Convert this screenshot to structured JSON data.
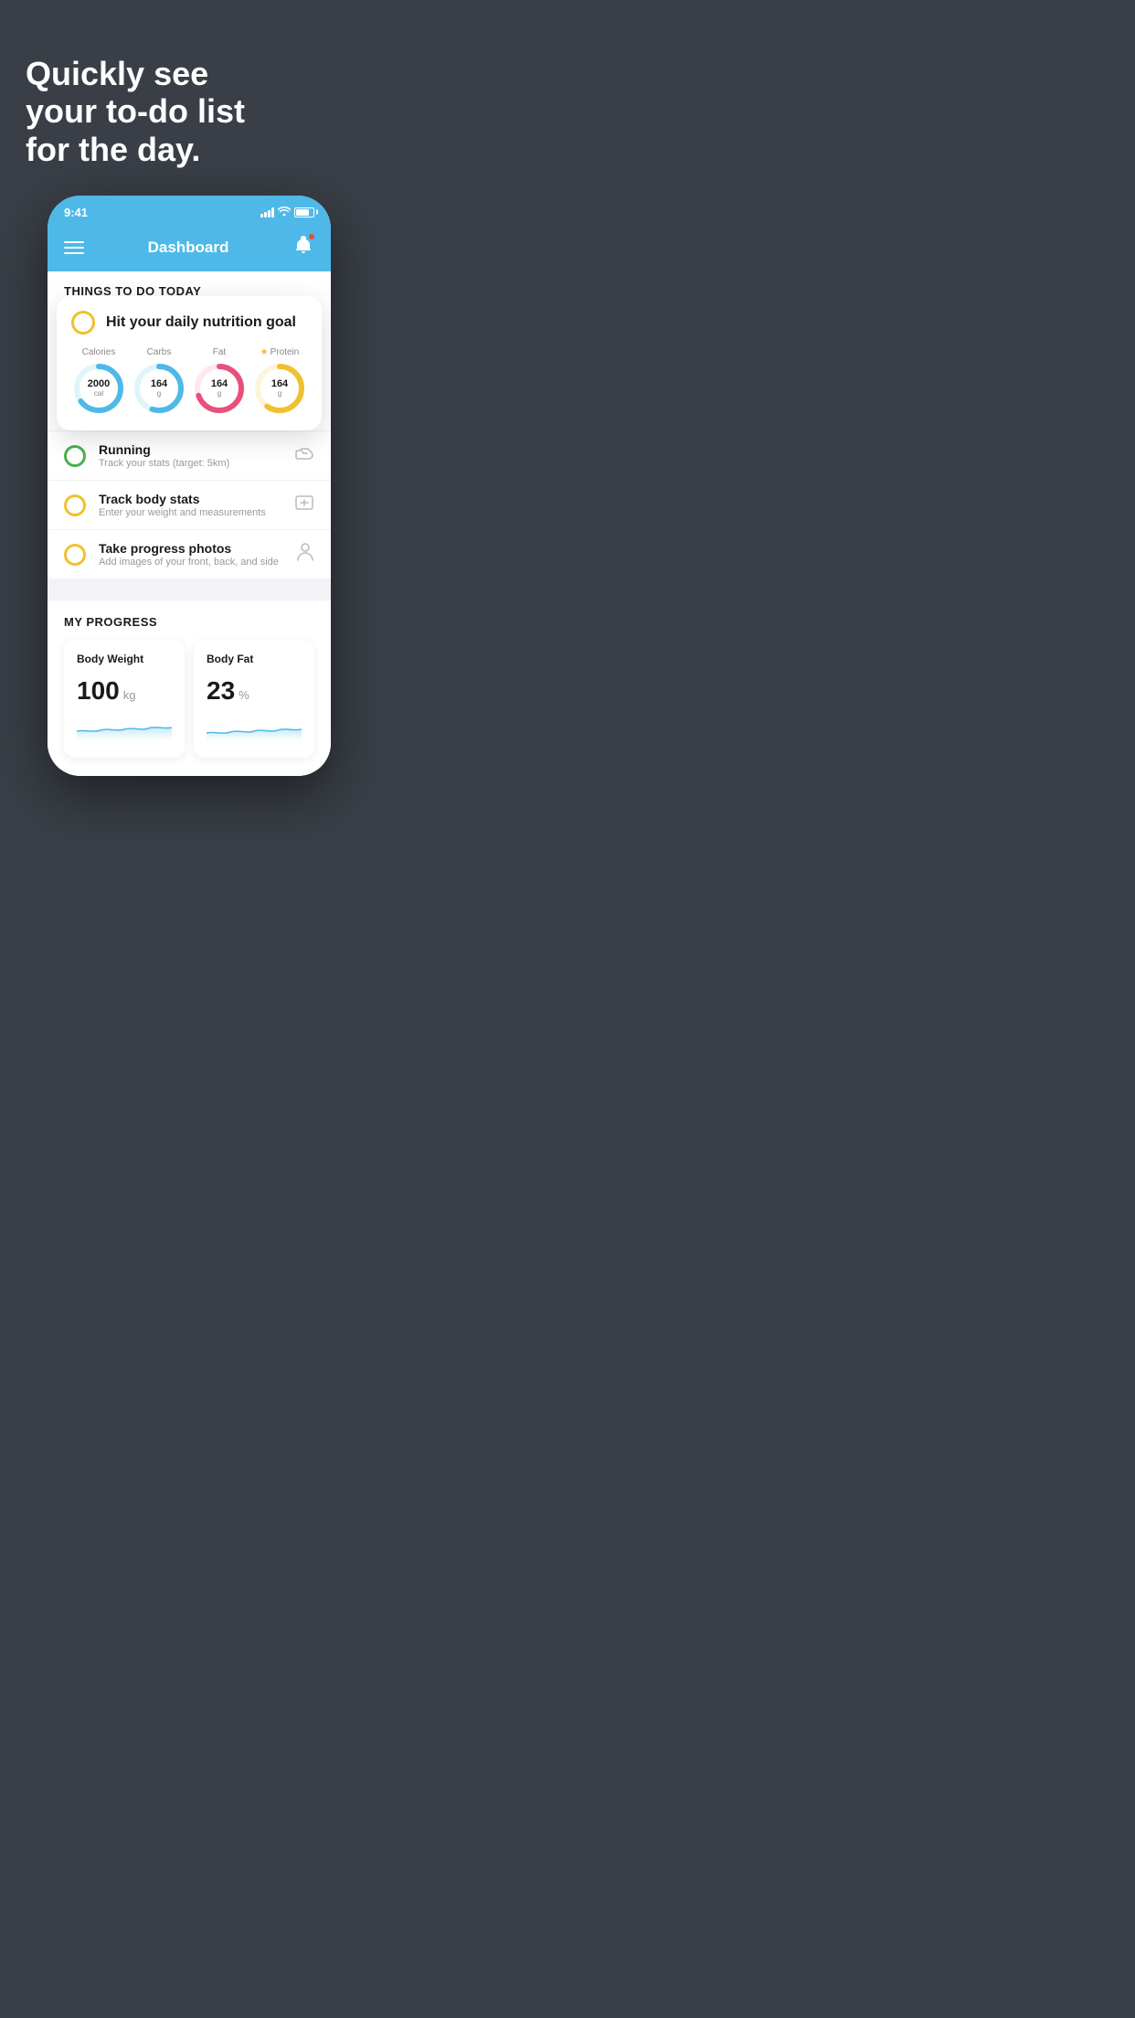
{
  "hero": {
    "line1": "Quickly see",
    "line2": "your to-do list",
    "line3": "for the day."
  },
  "statusBar": {
    "time": "9:41"
  },
  "navBar": {
    "title": "Dashboard"
  },
  "thingsToDoSection": {
    "header": "THINGS TO DO TODAY"
  },
  "nutritionCard": {
    "title": "Hit your daily nutrition goal",
    "items": [
      {
        "label": "Calories",
        "value": "2000",
        "unit": "cal",
        "color": "#4eb9e8",
        "trackColor": "#e0f4fb",
        "percent": 65,
        "star": false
      },
      {
        "label": "Carbs",
        "value": "164",
        "unit": "g",
        "color": "#4eb9e8",
        "trackColor": "#e0f4fb",
        "percent": 55,
        "star": false
      },
      {
        "label": "Fat",
        "value": "164",
        "unit": "g",
        "color": "#e8507a",
        "trackColor": "#fce8ee",
        "percent": 70,
        "star": false
      },
      {
        "label": "Protein",
        "value": "164",
        "unit": "g",
        "color": "#f0c030",
        "trackColor": "#fdf5dc",
        "percent": 60,
        "star": true
      }
    ]
  },
  "todoItems": [
    {
      "title": "Running",
      "subtitle": "Track your stats (target: 5km)",
      "circleColor": "green",
      "icon": "shoe"
    },
    {
      "title": "Track body stats",
      "subtitle": "Enter your weight and measurements",
      "circleColor": "yellow",
      "icon": "scale"
    },
    {
      "title": "Take progress photos",
      "subtitle": "Add images of your front, back, and side",
      "circleColor": "yellow",
      "icon": "person"
    }
  ],
  "progressSection": {
    "header": "MY PROGRESS",
    "cards": [
      {
        "title": "Body Weight",
        "value": "100",
        "unit": "kg"
      },
      {
        "title": "Body Fat",
        "value": "23",
        "unit": "%"
      }
    ]
  }
}
